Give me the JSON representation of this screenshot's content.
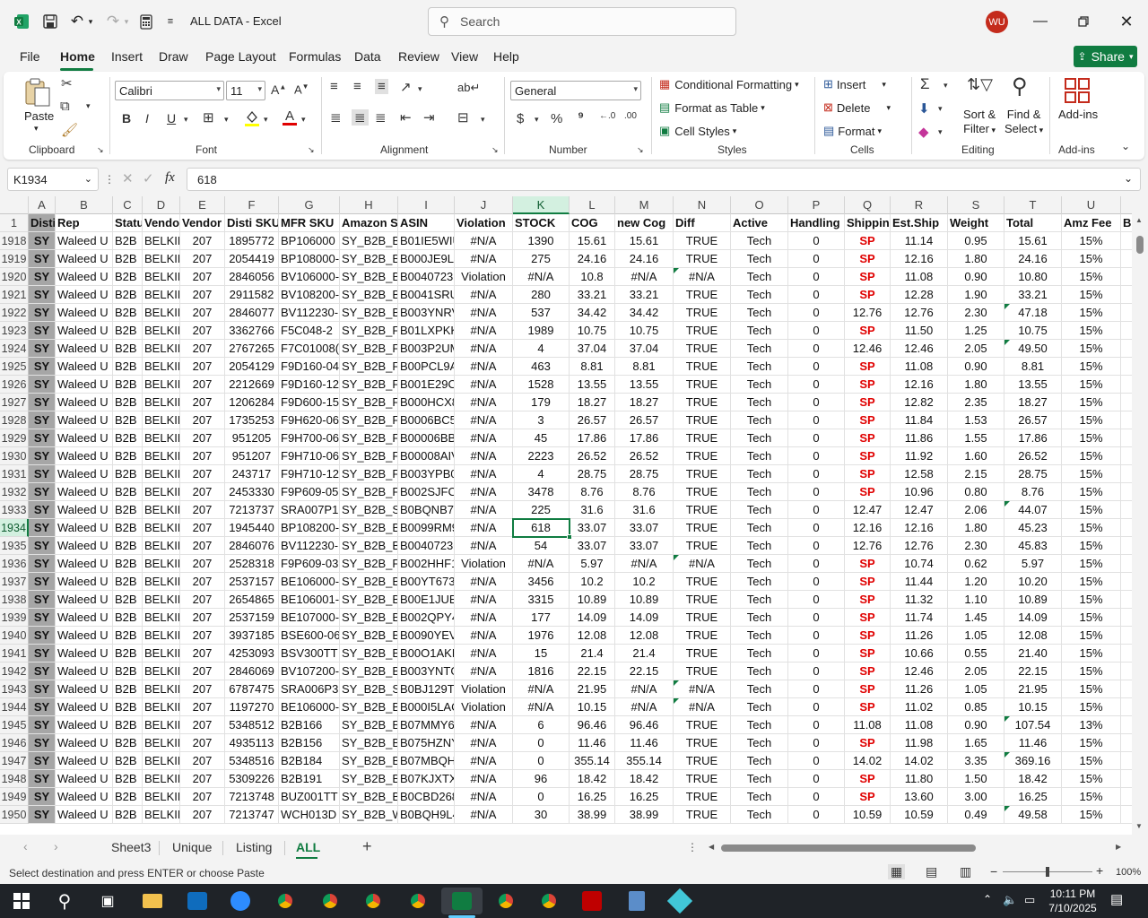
{
  "window": {
    "doc_title": "ALL DATA",
    "sep": "-",
    "app": "Excel",
    "user_initials": "WU"
  },
  "search": {
    "placeholder": "Search"
  },
  "tabs": [
    "File",
    "Home",
    "Insert",
    "Draw",
    "Page Layout",
    "Formulas",
    "Data",
    "Review",
    "View",
    "Help"
  ],
  "active_tab": "Home",
  "share_label": "Share",
  "ribbon": {
    "clipboard": {
      "label": "Clipboard",
      "paste": "Paste"
    },
    "font": {
      "label": "Font",
      "name": "Calibri",
      "size": "11"
    },
    "alignment": {
      "label": "Alignment"
    },
    "number": {
      "label": "Number",
      "format": "General"
    },
    "styles": {
      "label": "Styles",
      "conditional": "Conditional Formatting",
      "format_table": "Format as Table",
      "cell_styles": "Cell Styles"
    },
    "cells": {
      "label": "Cells",
      "insert": "Insert",
      "delete": "Delete",
      "format": "Format"
    },
    "editing": {
      "label": "Editing",
      "sort": "Sort &",
      "sort2": "Filter",
      "find": "Find &",
      "find2": "Select"
    },
    "addins": {
      "label": "Add-ins",
      "btn": "Add-ins"
    }
  },
  "formula_bar": {
    "name_box": "K1934",
    "fx": "fx",
    "value": "618"
  },
  "columns": [
    "A",
    "B",
    "C",
    "D",
    "E",
    "F",
    "G",
    "H",
    "I",
    "J",
    "K",
    "L",
    "M",
    "N",
    "O",
    "P",
    "Q",
    "R",
    "S",
    "T",
    "U",
    "V"
  ],
  "header_row": {
    "num": "1",
    "cells": [
      "Disti",
      "Rep",
      "Status",
      "Vendor",
      "Vendor",
      "Disti SKU",
      "MFR SKU",
      "Amazon SKU",
      "ASIN",
      "Violation",
      "STOCK",
      "COG",
      "new Cog",
      "Diff",
      "Active",
      "Handling",
      "Shipping",
      "Est.Ship",
      "Weight",
      "Total",
      "Amz Fee",
      "B"
    ]
  },
  "rows": [
    {
      "n": "1918",
      "f": "1895772",
      "g": "BP106000",
      "h": "SY_B2B_B",
      "i": "B01IE5WIU",
      "j": "#N/A",
      "k": "1390",
      "l": "15.61",
      "m": "15.61",
      "o": "TRUE",
      "q": "SP",
      "r": "11.14",
      "s": "0.95",
      "t": "15.61",
      "u": "15%"
    },
    {
      "n": "1919",
      "f": "2054419",
      "g": "BP108000-",
      "h": "SY_B2B_B",
      "i": "B000JE9LC",
      "j": "#N/A",
      "k": "275",
      "l": "24.16",
      "m": "24.16",
      "o": "TRUE",
      "q": "SP",
      "r": "12.16",
      "s": "1.80",
      "t": "24.16",
      "u": "15%"
    },
    {
      "n": "1920",
      "f": "2846056",
      "g": "BV106000-",
      "h": "SY_B2B_B",
      "i": "B0040723E",
      "j": "Violation",
      "k": "#N/A",
      "l": "10.8",
      "m": "#N/A",
      "o": "#N/A",
      "q": "SP",
      "r": "11.08",
      "s": "0.90",
      "t": "10.80",
      "u": "15%",
      "tri": [
        "o"
      ]
    },
    {
      "n": "1921",
      "f": "2911582",
      "g": "BV108200-",
      "h": "SY_B2B_B",
      "i": "B0041SRU",
      "j": "#N/A",
      "k": "280",
      "l": "33.21",
      "m": "33.21",
      "o": "TRUE",
      "q": "SP",
      "r": "12.28",
      "s": "1.90",
      "t": "33.21",
      "u": "15%"
    },
    {
      "n": "1922",
      "f": "2846077",
      "g": "BV112230-",
      "h": "SY_B2B_B",
      "i": "B003YNRV",
      "j": "#N/A",
      "k": "537",
      "l": "34.42",
      "m": "34.42",
      "o": "TRUE",
      "q": "12.76",
      "r": "12.76",
      "s": "2.30",
      "t": "47.18",
      "u": "15%",
      "tri": [
        "t"
      ]
    },
    {
      "n": "1923",
      "f": "3362766",
      "g": "F5C048-2",
      "h": "SY_B2B_F",
      "i": "B01LXPKK",
      "j": "#N/A",
      "k": "1989",
      "l": "10.75",
      "m": "10.75",
      "o": "TRUE",
      "q": "SP",
      "r": "11.50",
      "s": "1.25",
      "t": "10.75",
      "u": "15%"
    },
    {
      "n": "1924",
      "f": "2767265",
      "g": "F7C01008(",
      "h": "SY_B2B_F7",
      "i": "B003P2UM",
      "j": "#N/A",
      "k": "4",
      "l": "37.04",
      "m": "37.04",
      "o": "TRUE",
      "q": "12.46",
      "r": "12.46",
      "s": "2.05",
      "t": "49.50",
      "u": "15%",
      "tri": [
        "t"
      ]
    },
    {
      "n": "1925",
      "f": "2054129",
      "g": "F9D160-04",
      "h": "SY_B2B_F9",
      "i": "B00PCL9A",
      "j": "#N/A",
      "k": "463",
      "l": "8.81",
      "m": "8.81",
      "o": "TRUE",
      "q": "SP",
      "r": "11.08",
      "s": "0.90",
      "t": "8.81",
      "u": "15%"
    },
    {
      "n": "1926",
      "f": "2212669",
      "g": "F9D160-12",
      "h": "SY_B2B_F9",
      "i": "B001E29O",
      "j": "#N/A",
      "k": "1528",
      "l": "13.55",
      "m": "13.55",
      "o": "TRUE",
      "q": "SP",
      "r": "12.16",
      "s": "1.80",
      "t": "13.55",
      "u": "15%"
    },
    {
      "n": "1927",
      "f": "1206284",
      "g": "F9D600-15",
      "h": "SY_B2B_F9",
      "i": "B000HCX8",
      "j": "#N/A",
      "k": "179",
      "l": "18.27",
      "m": "18.27",
      "o": "TRUE",
      "q": "SP",
      "r": "12.82",
      "s": "2.35",
      "t": "18.27",
      "u": "15%"
    },
    {
      "n": "1928",
      "f": "1735253",
      "g": "F9H620-06",
      "h": "SY_B2B_F9",
      "i": "B0006BC5Y",
      "j": "#N/A",
      "k": "3",
      "l": "26.57",
      "m": "26.57",
      "o": "TRUE",
      "q": "SP",
      "r": "11.84",
      "s": "1.53",
      "t": "26.57",
      "u": "15%"
    },
    {
      "n": "1929",
      "f": "951205",
      "g": "F9H700-06",
      "h": "SY_B2B_F9",
      "i": "B00006BB/",
      "j": "#N/A",
      "k": "45",
      "l": "17.86",
      "m": "17.86",
      "o": "TRUE",
      "q": "SP",
      "r": "11.86",
      "s": "1.55",
      "t": "17.86",
      "u": "15%"
    },
    {
      "n": "1930",
      "f": "951207",
      "g": "F9H710-06",
      "h": "SY_B2B_F9",
      "i": "B00008AIV",
      "j": "#N/A",
      "k": "2223",
      "l": "26.52",
      "m": "26.52",
      "o": "TRUE",
      "q": "SP",
      "r": "11.92",
      "s": "1.60",
      "t": "26.52",
      "u": "15%"
    },
    {
      "n": "1931",
      "f": "243717",
      "g": "F9H710-12",
      "h": "SY_B2B_F9",
      "i": "B003YPB0T",
      "j": "#N/A",
      "k": "4",
      "l": "28.75",
      "m": "28.75",
      "o": "TRUE",
      "q": "SP",
      "r": "12.58",
      "s": "2.15",
      "t": "28.75",
      "u": "15%"
    },
    {
      "n": "1932",
      "f": "2453330",
      "g": "F9P609-05",
      "h": "SY_B2B_F9",
      "i": "B002SJFC2",
      "j": "#N/A",
      "k": "3478",
      "l": "8.76",
      "m": "8.76",
      "o": "TRUE",
      "q": "SP",
      "r": "10.96",
      "s": "0.80",
      "t": "8.76",
      "u": "15%"
    },
    {
      "n": "1933",
      "f": "7213737",
      "g": "SRA007P1",
      "h": "SY_B2B_SI",
      "i": "B0BQNB74",
      "j": "#N/A",
      "k": "225",
      "l": "31.6",
      "m": "31.6",
      "o": "TRUE",
      "q": "12.47",
      "r": "12.47",
      "s": "2.06",
      "t": "44.07",
      "u": "15%",
      "tri": [
        "t"
      ]
    },
    {
      "n": "1934",
      "f": "1945440",
      "g": "BP108200-",
      "h": "SY_B2B_B",
      "i": "B0099RM9",
      "j": "#N/A",
      "k": "618",
      "l": "33.07",
      "m": "33.07",
      "o": "TRUE",
      "q": "12.16",
      "r": "12.16",
      "s": "1.80",
      "t": "45.23",
      "u": "15%"
    },
    {
      "n": "1935",
      "f": "2846076",
      "g": "BV112230-",
      "h": "SY_B2B_B",
      "i": "B0040723C",
      "j": "#N/A",
      "k": "54",
      "l": "33.07",
      "m": "33.07",
      "o": "TRUE",
      "q": "12.76",
      "r": "12.76",
      "s": "2.30",
      "t": "45.83",
      "u": "15%"
    },
    {
      "n": "1936",
      "f": "2528318",
      "g": "F9P609-03",
      "h": "SY_B2B_F9",
      "i": "B002HHF1",
      "j": "Violation",
      "k": "#N/A",
      "l": "5.97",
      "m": "#N/A",
      "o": "#N/A",
      "q": "SP",
      "r": "10.74",
      "s": "0.62",
      "t": "5.97",
      "u": "15%",
      "tri": [
        "o"
      ]
    },
    {
      "n": "1937",
      "f": "2537157",
      "g": "BE106000-",
      "h": "SY_B2B_B",
      "i": "B00YT673E",
      "j": "#N/A",
      "k": "3456",
      "l": "10.2",
      "m": "10.2",
      "o": "TRUE",
      "q": "SP",
      "r": "11.44",
      "s": "1.20",
      "t": "10.20",
      "u": "15%"
    },
    {
      "n": "1938",
      "f": "2654865",
      "g": "BE106001-",
      "h": "SY_B2B_B",
      "i": "B00E1JUEK",
      "j": "#N/A",
      "k": "3315",
      "l": "10.89",
      "m": "10.89",
      "o": "TRUE",
      "q": "SP",
      "r": "11.32",
      "s": "1.10",
      "t": "10.89",
      "u": "15%"
    },
    {
      "n": "1939",
      "f": "2537159",
      "g": "BE107000-",
      "h": "SY_B2B_B",
      "i": "B002QPY4",
      "j": "#N/A",
      "k": "177",
      "l": "14.09",
      "m": "14.09",
      "o": "TRUE",
      "q": "SP",
      "r": "11.74",
      "s": "1.45",
      "t": "14.09",
      "u": "15%"
    },
    {
      "n": "1940",
      "f": "3937185",
      "g": "BSE600-06",
      "h": "SY_B2B_B",
      "i": "B0090YEV",
      "j": "#N/A",
      "k": "1976",
      "l": "12.08",
      "m": "12.08",
      "o": "TRUE",
      "q": "SP",
      "r": "11.26",
      "s": "1.05",
      "t": "12.08",
      "u": "15%"
    },
    {
      "n": "1941",
      "f": "4253093",
      "g": "BSV300TT",
      "h": "SY_B2B_B",
      "i": "B00O1AKE",
      "j": "#N/A",
      "k": "15",
      "l": "21.4",
      "m": "21.4",
      "o": "TRUE",
      "q": "SP",
      "r": "10.66",
      "s": "0.55",
      "t": "21.40",
      "u": "15%"
    },
    {
      "n": "1942",
      "f": "2846069",
      "g": "BV107200-",
      "h": "SY_B2B_B",
      "i": "B003YNTG",
      "j": "#N/A",
      "k": "1816",
      "l": "22.15",
      "m": "22.15",
      "o": "TRUE",
      "q": "SP",
      "r": "12.46",
      "s": "2.05",
      "t": "22.15",
      "u": "15%"
    },
    {
      "n": "1943",
      "f": "6787475",
      "g": "SRA006P3",
      "h": "SY_B2B_SI",
      "i": "B0BJ129TT",
      "j": "Violation",
      "k": "#N/A",
      "l": "21.95",
      "m": "#N/A",
      "o": "#N/A",
      "q": "SP",
      "r": "11.26",
      "s": "1.05",
      "t": "21.95",
      "u": "15%",
      "tri": [
        "o"
      ]
    },
    {
      "n": "1944",
      "f": "1197270",
      "g": "BE106000-",
      "h": "SY_B2B_B",
      "i": "B000I5LAC",
      "j": "Violation",
      "k": "#N/A",
      "l": "10.15",
      "m": "#N/A",
      "o": "#N/A",
      "q": "SP",
      "r": "11.02",
      "s": "0.85",
      "t": "10.15",
      "u": "15%",
      "tri": [
        "o"
      ]
    },
    {
      "n": "1945",
      "f": "5348512",
      "g": "B2B166",
      "h": "SY_B2B_B",
      "i": "B07MMY6",
      "j": "#N/A",
      "k": "6",
      "l": "96.46",
      "m": "96.46",
      "o": "TRUE",
      "q": "11.08",
      "r": "11.08",
      "s": "0.90",
      "t": "107.54",
      "u": "13%",
      "tri": [
        "t"
      ]
    },
    {
      "n": "1946",
      "f": "4935113",
      "g": "B2B156",
      "h": "SY_B2B_B",
      "i": "B075HZNY",
      "j": "#N/A",
      "k": "0",
      "l": "11.46",
      "m": "11.46",
      "o": "TRUE",
      "q": "SP",
      "r": "11.98",
      "s": "1.65",
      "t": "11.46",
      "u": "15%"
    },
    {
      "n": "1947",
      "f": "5348516",
      "g": "B2B184",
      "h": "SY_B2B_B",
      "i": "B07MBQH",
      "j": "#N/A",
      "k": "0",
      "l": "355.14",
      "m": "355.14",
      "o": "TRUE",
      "q": "14.02",
      "r": "14.02",
      "s": "3.35",
      "t": "369.16",
      "u": "15%",
      "tri": [
        "t"
      ]
    },
    {
      "n": "1948",
      "f": "5309226",
      "g": "B2B191",
      "h": "SY_B2B_B",
      "i": "B07KJXTX",
      "j": "#N/A",
      "k": "96",
      "l": "18.42",
      "m": "18.42",
      "o": "TRUE",
      "q": "SP",
      "r": "11.80",
      "s": "1.50",
      "t": "18.42",
      "u": "15%"
    },
    {
      "n": "1949",
      "f": "7213748",
      "g": "BUZ001TT",
      "h": "SY_B2B_B",
      "i": "B0CBD268",
      "j": "#N/A",
      "k": "0",
      "l": "16.25",
      "m": "16.25",
      "o": "TRUE",
      "q": "SP",
      "r": "13.60",
      "s": "3.00",
      "t": "16.25",
      "u": "15%"
    },
    {
      "n": "1950",
      "f": "7213747",
      "g": "WCH013D",
      "h": "SY_B2B_W",
      "i": "B0BQH9L4",
      "j": "#N/A",
      "k": "30",
      "l": "38.99",
      "m": "38.99",
      "o": "TRUE",
      "q": "10.59",
      "r": "10.59",
      "s": "0.49",
      "t": "49.58",
      "u": "15%",
      "tri": [
        "t"
      ]
    }
  ],
  "common": {
    "a": "SY",
    "b": "Waleed U",
    "c": "B2B",
    "d": "BELKIN",
    "e": "207",
    "p": "Tech",
    "hand": "0"
  },
  "sheets": [
    "Sheet3",
    "Unique",
    "Listing",
    "ALL"
  ],
  "active_sheet": "ALL",
  "status": {
    "message": "Select destination and press ENTER or choose Paste",
    "zoom": "100%"
  },
  "clock": {
    "time": "10:11 PM",
    "date": "7/10/2025"
  },
  "colors": {
    "accent": "#107c41",
    "sp": "#e00000",
    "colA": "#a6a6a6",
    "selected_bg": "#d3f0e0"
  }
}
